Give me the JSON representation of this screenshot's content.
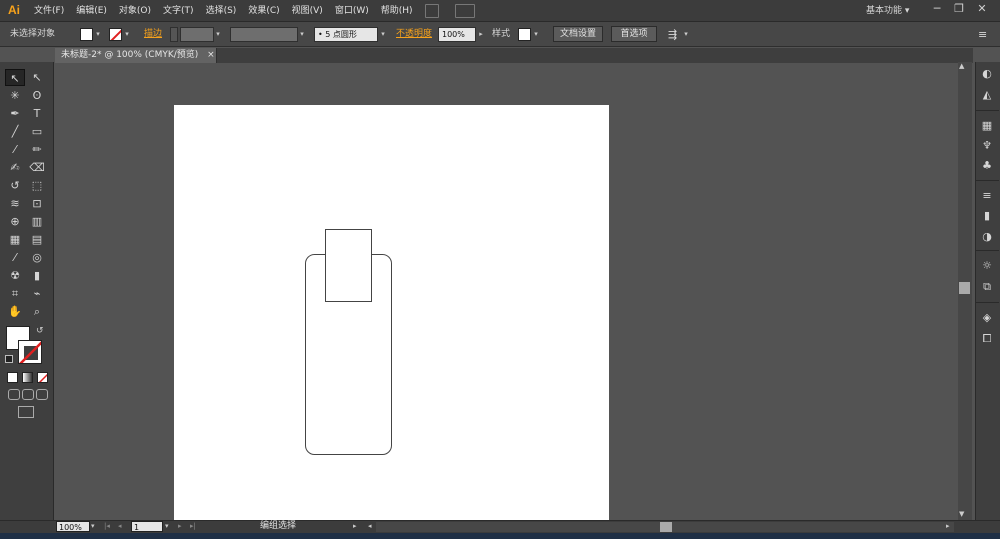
{
  "app": {
    "logo": "Ai"
  },
  "menu": {
    "items": [
      "文件(F)",
      "编辑(E)",
      "对象(O)",
      "文字(T)",
      "选择(S)",
      "效果(C)",
      "视图(V)",
      "窗口(W)",
      "帮助(H)"
    ],
    "workspace": "基本功能",
    "workspace_arrow": "▾",
    "minimize": "─",
    "restore": "❐",
    "close": "✕"
  },
  "control": {
    "selection_status": "未选择对象",
    "stroke_label": "描边",
    "brush": "5 点圆形",
    "opacity_label": "不透明度",
    "opacity_value": "100%",
    "style_label": "样式",
    "document_setup": "文档设置",
    "preferences": "首选项"
  },
  "document": {
    "tab_title": "未标题-2* @ 100% (CMYK/预览)",
    "tab_close": "×"
  },
  "tools": [
    {
      "name": "selection-tool-icon",
      "glyph": "↖"
    },
    {
      "name": "direct-selection-tool-icon",
      "glyph": "↖"
    },
    {
      "name": "magic-wand-tool-icon",
      "glyph": "✳"
    },
    {
      "name": "lasso-tool-icon",
      "glyph": "ʘ"
    },
    {
      "name": "pen-tool-icon",
      "glyph": "✒"
    },
    {
      "name": "type-tool-icon",
      "glyph": "T"
    },
    {
      "name": "line-tool-icon",
      "glyph": "╱"
    },
    {
      "name": "rectangle-tool-icon",
      "glyph": "▭"
    },
    {
      "name": "paintbrush-tool-icon",
      "glyph": "⁄"
    },
    {
      "name": "pencil-tool-icon",
      "glyph": "✏"
    },
    {
      "name": "blob-brush-tool-icon",
      "glyph": "✍"
    },
    {
      "name": "eraser-tool-icon",
      "glyph": "⌫"
    },
    {
      "name": "rotate-tool-icon",
      "glyph": "↺"
    },
    {
      "name": "scale-tool-icon",
      "glyph": "⬚"
    },
    {
      "name": "width-tool-icon",
      "glyph": "≋"
    },
    {
      "name": "free-transform-tool-icon",
      "glyph": "⊡"
    },
    {
      "name": "shape-builder-tool-icon",
      "glyph": "⊕"
    },
    {
      "name": "perspective-grid-tool-icon",
      "glyph": "▥"
    },
    {
      "name": "mesh-tool-icon",
      "glyph": "▦"
    },
    {
      "name": "gradient-tool-icon",
      "glyph": "▤"
    },
    {
      "name": "eyedropper-tool-icon",
      "glyph": "⁄"
    },
    {
      "name": "blend-tool-icon",
      "glyph": "◎"
    },
    {
      "name": "symbol-sprayer-tool-icon",
      "glyph": "☢"
    },
    {
      "name": "column-graph-tool-icon",
      "glyph": "▮"
    },
    {
      "name": "artboard-tool-icon",
      "glyph": "⌗"
    },
    {
      "name": "slice-tool-icon",
      "glyph": "⌁"
    },
    {
      "name": "hand-tool-icon",
      "glyph": "✋"
    },
    {
      "name": "zoom-tool-icon",
      "glyph": "⌕"
    }
  ],
  "right_panel": [
    {
      "name": "color-panel-icon",
      "glyph": "◐"
    },
    {
      "name": "color-guide-panel-icon",
      "glyph": "◭"
    },
    {
      "name": "swatches-panel-icon",
      "glyph": "▦"
    },
    {
      "name": "brushes-panel-icon",
      "glyph": "♆"
    },
    {
      "name": "symbols-panel-icon",
      "glyph": "♣"
    },
    {
      "name": "stroke-panel-icon",
      "glyph": "≡"
    },
    {
      "name": "gradient-panel-icon",
      "glyph": "▮"
    },
    {
      "name": "transparency-panel-icon",
      "glyph": "◑"
    },
    {
      "name": "appearance-panel-icon",
      "glyph": "☼"
    },
    {
      "name": "graphic-styles-panel-icon",
      "glyph": "⧉"
    },
    {
      "name": "layers-panel-icon",
      "glyph": "◈"
    },
    {
      "name": "artboards-panel-icon",
      "glyph": "⧠"
    }
  ],
  "status": {
    "zoom": "100%",
    "artboard_number": "1",
    "tool_status": "编组选择",
    "first": "|◂",
    "prev": "◂",
    "next": "▸",
    "last": "▸|"
  }
}
